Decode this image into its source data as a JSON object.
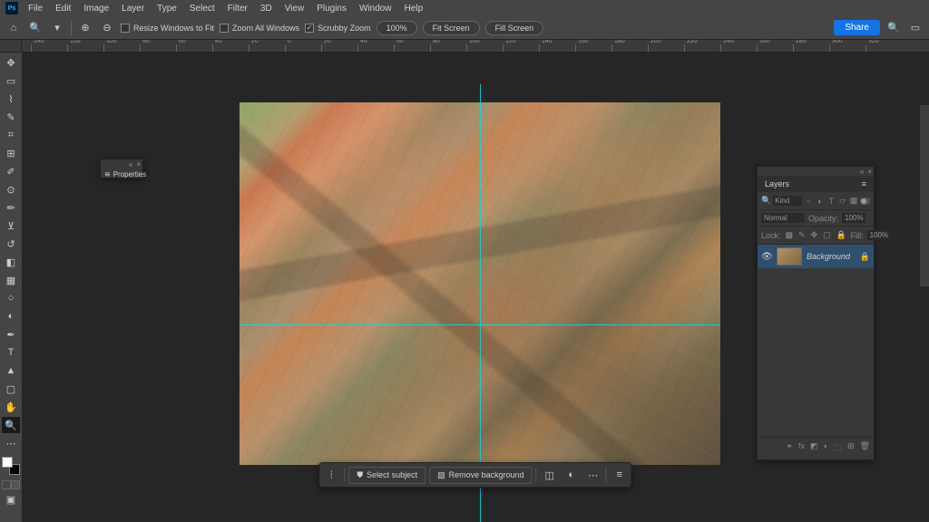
{
  "menubar": [
    "File",
    "Edit",
    "Image",
    "Layer",
    "Type",
    "Select",
    "Filter",
    "3D",
    "View",
    "Plugins",
    "Window",
    "Help"
  ],
  "app_logo": "Ps",
  "options": {
    "resize_label": "Resize Windows to Fit",
    "zoom_all_label": "Zoom All Windows",
    "scrubby_label": "Scrubby Zoom",
    "zoom_value": "100%",
    "fit_screen": "Fit Screen",
    "fill_screen": "Fill Screen",
    "share": "Share"
  },
  "ruler_ticks": [
    "140",
    "120",
    "100",
    "80",
    "60",
    "40",
    "20",
    "0",
    "20",
    "40",
    "60",
    "80",
    "100",
    "120",
    "140",
    "160",
    "180",
    "200",
    "220",
    "240",
    "260",
    "280",
    "300",
    "320"
  ],
  "properties_panel": {
    "title": "Properties"
  },
  "layers_panel": {
    "title": "Layers",
    "filter_kind": "Kind",
    "blend_mode": "Normal",
    "opacity_label": "Opacity:",
    "opacity_value": "100%",
    "lock_label": "Lock:",
    "fill_label": "Fill:",
    "fill_value": "100%",
    "layer": {
      "name": "Background"
    }
  },
  "taskbar": {
    "select_subject": "Select subject",
    "remove_bg": "Remove background"
  }
}
